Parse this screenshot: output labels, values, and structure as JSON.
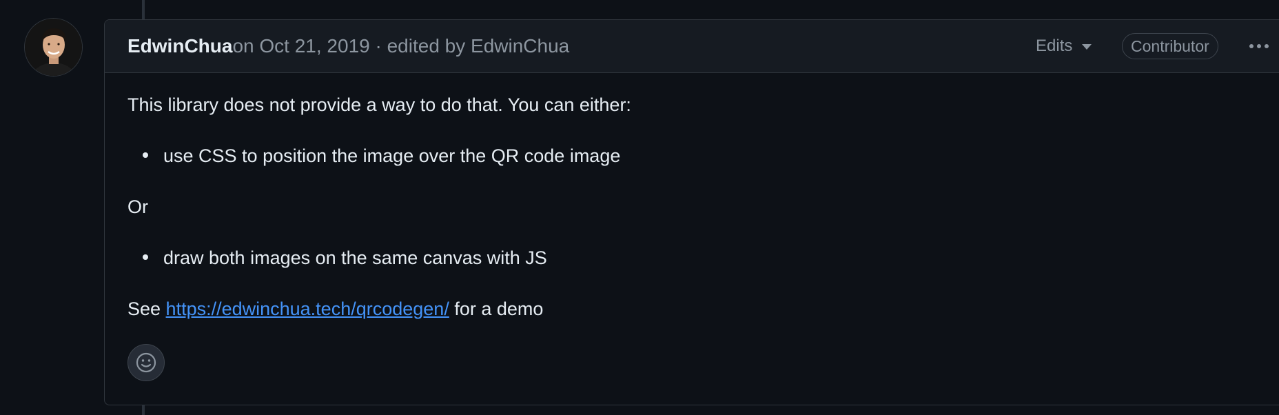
{
  "comment": {
    "author": "EdwinChua",
    "date_prefix": " on Oct 21, 2019",
    "edited_text": " · edited by ",
    "editor": "EdwinChua",
    "edits_label": "Edits",
    "role_badge": "Contributor",
    "avatar_icon": "avatar-photo",
    "body": {
      "p1": "This library does not provide a way to do that. You can either:",
      "list1": "use CSS to position the image over the QR code image",
      "p2": "Or",
      "list2": "draw both images on the same canvas with JS",
      "p3_prefix": "See ",
      "p3_link": "https://edwinchua.tech/qrcodegen/",
      "p3_suffix": " for a demo"
    },
    "reaction_icon": "smiley-icon",
    "menu_icon": "kebab-horizontal-icon"
  },
  "colors": {
    "background": "#0d1117",
    "header_bg": "#161b22",
    "border": "#30363d",
    "link": "#4493f8",
    "muted": "#8d96a0"
  }
}
